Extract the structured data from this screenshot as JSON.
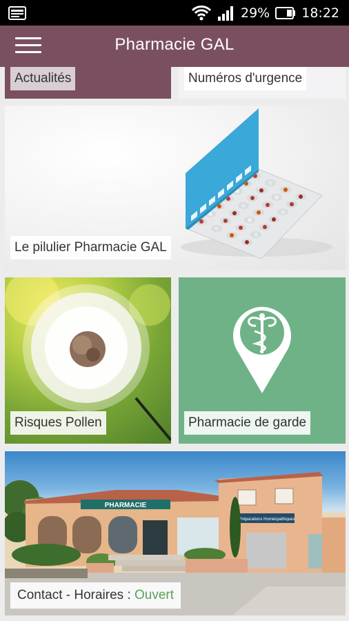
{
  "status_bar": {
    "battery_percent": "29%",
    "time": "18:22",
    "icons": [
      "notification-icon",
      "wifi-icon",
      "signal-icon",
      "battery-icon"
    ]
  },
  "app_bar": {
    "title": "Pharmacie GAL",
    "menu_icon": "hamburger-menu-icon"
  },
  "tiles": {
    "actualites": "Actualités",
    "urgence": "Numéros d'urgence",
    "pilulier": "Le pilulier Pharmacie GAL",
    "pollen": "Risques Pollen",
    "garde": "Pharmacie de garde",
    "contact_prefix": "Contact - Horaires : ",
    "contact_status": "Ouvert"
  },
  "shop": {
    "sign": "PHARMACIE",
    "side_sign": "Préparations Homéopathiques"
  },
  "colors": {
    "app_bar": "#7a5060",
    "garde_tile": "#6fb287",
    "open_status": "#5aa05a"
  }
}
